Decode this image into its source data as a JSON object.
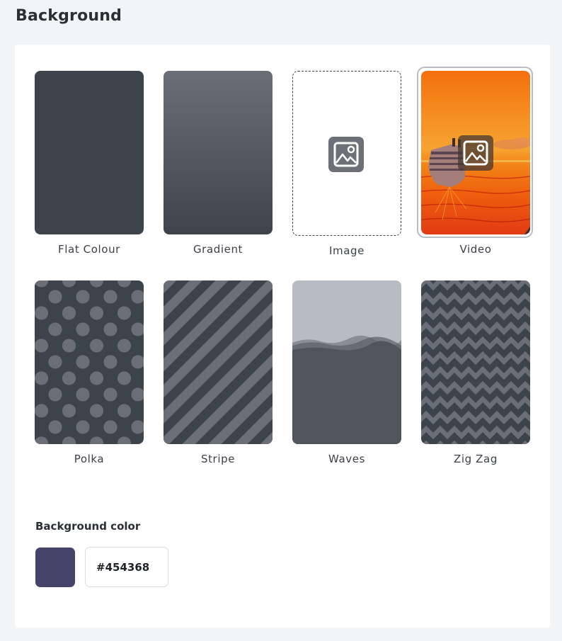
{
  "header": {
    "title": "Background"
  },
  "tiles": [
    {
      "label": "Flat Colour"
    },
    {
      "label": "Gradient"
    },
    {
      "label": "Image"
    },
    {
      "label": "Video",
      "selected": true
    },
    {
      "label": "Polka"
    },
    {
      "label": "Stripe"
    },
    {
      "label": "Waves"
    },
    {
      "label": "Zig Zag"
    }
  ],
  "background_color": {
    "label": "Background color",
    "value": "#454368",
    "swatch_color": "#454368"
  },
  "icons": {
    "image_placeholder": "image-icon"
  },
  "colors": {
    "tile_dark": "#3d434b",
    "pattern_light": "#6b6e76",
    "selected_outline": "#b9bcc2",
    "video_orange": "#f4700c"
  }
}
